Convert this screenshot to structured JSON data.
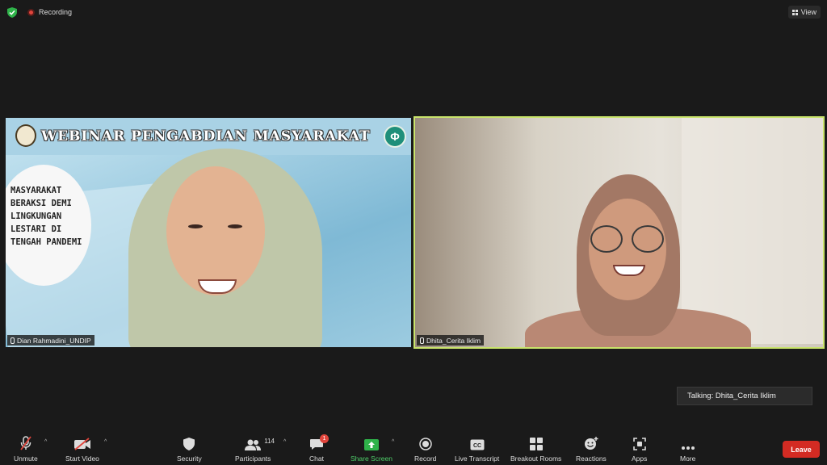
{
  "top_bar": {
    "recording_label": "Recording",
    "view_label": "View"
  },
  "participants": [
    {
      "name": "Dian Rahmadini_UNDIP",
      "slide": {
        "banner_title": "WEBINAR PENGABDIAN MASYARAKAT",
        "circle_text": "MASYARAKAT BERAKSI DEMI LINGKUNGAN LESTARI DI TENGAH PANDEMI",
        "logo_right_text": "Φ"
      }
    },
    {
      "name": "Dhita_Cerita Iklim",
      "active_speaker": true
    }
  ],
  "talking_indicator": "Talking: Dhita_Cerita Iklim",
  "toolbar": {
    "unmute": "Unmute",
    "start_video": "Start Video",
    "security": "Security",
    "participants": "Participants",
    "participants_count": "114",
    "chat": "Chat",
    "chat_badge": "1",
    "share_screen": "Share Screen",
    "record": "Record",
    "live_transcript": "Live Transcript",
    "breakout_rooms": "Breakout Rooms",
    "reactions": "Reactions",
    "apps": "Apps",
    "more": "More",
    "leave": "Leave"
  },
  "colors": {
    "active_speaker_border": "#c9e46b",
    "share_screen_green": "#4fcf6a",
    "leave_red": "#d32b23",
    "recording_red": "#e0453c"
  }
}
